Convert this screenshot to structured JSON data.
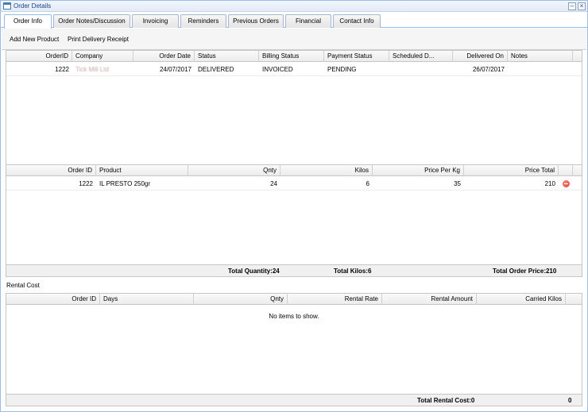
{
  "window": {
    "title": "Order Details"
  },
  "tabs": [
    {
      "label": "Order Info"
    },
    {
      "label": "Order Notes/Discussion"
    },
    {
      "label": "Invoicing"
    },
    {
      "label": "Reminders"
    },
    {
      "label": "Previous Orders"
    },
    {
      "label": "Financial"
    },
    {
      "label": "Contact Info"
    }
  ],
  "toolbar": {
    "add_product": "Add New Product",
    "print_receipt": "Print Delivery Receipt"
  },
  "orders": {
    "columns": [
      "OrderID",
      "Company",
      "Order Date",
      "Status",
      "Billing Status",
      "Payment Status",
      "Scheduled D...",
      "Delivered On",
      "Notes"
    ],
    "rows": [
      {
        "order_id": "1222",
        "company": "Tick Mill Ltd",
        "order_date": "24/07/2017",
        "status": "DELIVERED",
        "billing_status": "INVOICED",
        "payment_status": "PENDING",
        "scheduled": "",
        "delivered_on": "26/07/2017",
        "notes": ""
      }
    ]
  },
  "products": {
    "columns": [
      "Order ID",
      "Product",
      "Qnty",
      "Kilos",
      "Price Per Kg",
      "Price Total"
    ],
    "rows": [
      {
        "order_id": "1222",
        "product": "IL PRESTO 250gr",
        "qnty": "24",
        "kilos": "6",
        "price_per_kg": "35",
        "price_total": "210"
      }
    ],
    "summary": {
      "total_quantity": "Total Quantity:24",
      "total_kilos": "Total Kilos:6",
      "total_order_price": "Total Order Price:210"
    }
  },
  "rental": {
    "label": "Rental Cost",
    "columns": [
      "Order ID",
      "Days",
      "Qnty",
      "Rental Rate",
      "Rental Amount",
      "Carried Kilos"
    ],
    "empty_text": "No items to show.",
    "summary": {
      "total_rental_cost": "Total Rental Cost:0",
      "total_value": "0"
    }
  }
}
